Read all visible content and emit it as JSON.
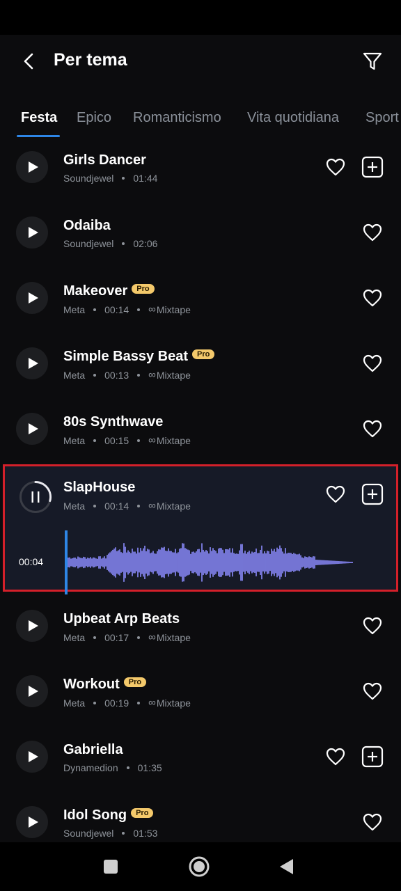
{
  "header": {
    "title": "Per tema",
    "back_icon": "back-arrow-icon",
    "filter_icon": "filter-icon"
  },
  "tabs": [
    {
      "label": "Festa",
      "active": true
    },
    {
      "label": "Epico",
      "active": false
    },
    {
      "label": "Romanticismo",
      "active": false
    },
    {
      "label": "Vita quotidiana",
      "active": false
    },
    {
      "label": "Sport",
      "active": false
    }
  ],
  "tracks": [
    {
      "title": "Girls Dancer",
      "artist": "Soundjewel",
      "duration": "01:44",
      "pro": false,
      "mixtape": false,
      "add": true
    },
    {
      "title": "Odaiba",
      "artist": "Soundjewel",
      "duration": "02:06",
      "pro": false,
      "mixtape": false,
      "add": false
    },
    {
      "title": "Makeover",
      "artist": "Meta",
      "duration": "00:14",
      "pro": true,
      "mixtape": true,
      "add": false
    },
    {
      "title": "Simple Bassy Beat",
      "artist": "Meta",
      "duration": "00:13",
      "pro": true,
      "mixtape": true,
      "add": false
    },
    {
      "title": "80s Synthwave",
      "artist": "Meta",
      "duration": "00:15",
      "pro": false,
      "mixtape": true,
      "add": false
    },
    {
      "title": "SlapHouse",
      "artist": "Meta",
      "duration": "00:14",
      "pro": false,
      "mixtape": true,
      "add": true,
      "playing": true,
      "elapsed": "00:04"
    },
    {
      "title": "Upbeat Arp Beats",
      "artist": "Meta",
      "duration": "00:17",
      "pro": false,
      "mixtape": true,
      "add": false
    },
    {
      "title": "Workout",
      "artist": "Meta",
      "duration": "00:19",
      "pro": true,
      "mixtape": true,
      "add": false
    },
    {
      "title": "Gabriella",
      "artist": "Dynamedion",
      "duration": "01:35",
      "pro": false,
      "mixtape": false,
      "add": true
    },
    {
      "title": "Idol Song",
      "artist": "Soundjewel",
      "duration": "01:53",
      "pro": true,
      "mixtape": false,
      "add": false
    }
  ],
  "labels": {
    "pro": "Pro",
    "mixtape": "Mixtape"
  },
  "playback": {
    "progress": 0.0,
    "elapsed": "00:04"
  },
  "colors": {
    "accent": "#2e86e6",
    "pro_badge": "#f4c96b",
    "waveform": "#8c8cff",
    "highlight_border": "#d4202a"
  },
  "navigation": {
    "recents_icon": "square-icon",
    "home_icon": "circle-home-icon",
    "back_icon": "triangle-back-icon"
  }
}
